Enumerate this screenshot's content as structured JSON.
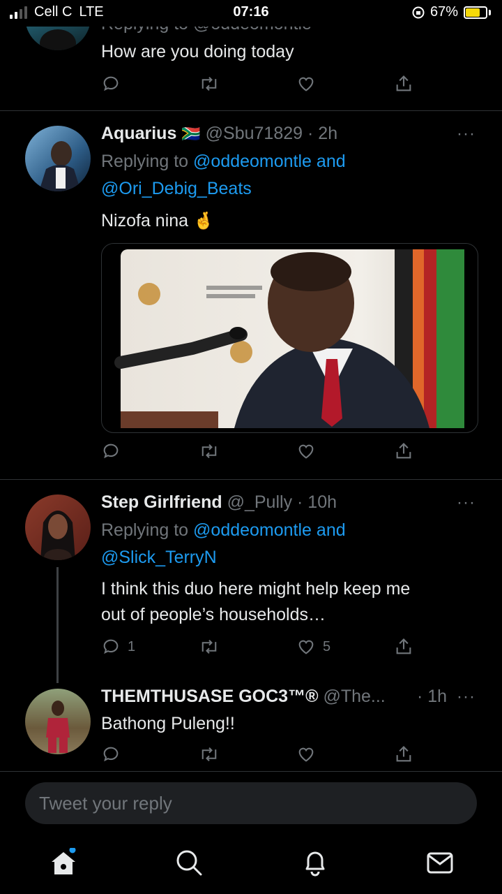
{
  "status_bar": {
    "carrier": "Cell C",
    "network": "LTE",
    "time": "07:16",
    "battery": "67%"
  },
  "tweets": [
    {
      "reply_prefix_partial": "Replying to @oddeomontle",
      "text": "How are you doing today"
    },
    {
      "name": "Aquarius",
      "flag": "🇿🇦",
      "handle": "@Sbu71829",
      "time": "· 2h",
      "reply_prefix": "Replying to",
      "reply_to_1": "@oddeomontle",
      "reply_and": "and",
      "reply_to_2": "@Ori_Debig_Beats",
      "text": "Nizofa nina",
      "emoji": "🤞"
    },
    {
      "name": "Step Girlfriend",
      "handle": "@_Pully",
      "time": "· 10h",
      "reply_prefix": "Replying to",
      "reply_to_1": "@oddeomontle",
      "reply_and": "and",
      "reply_to_2": "@Slick_TerryN",
      "text_line1": "I think this duo here might help keep me",
      "text_line2": "out of people’s households…",
      "reply_count": "1",
      "like_count": "5"
    },
    {
      "name": "THEMTHUSASE GOC3™®",
      "handle": "@The...",
      "time": "· 1h",
      "text": "Bathong Puleng!!"
    }
  ],
  "more_icon": "···",
  "reply_input": {
    "placeholder": "Tweet your reply"
  },
  "tabbar": {
    "items": [
      "home-icon",
      "search-icon",
      "notifications-icon",
      "messages-icon"
    ]
  },
  "colors": {
    "link": "#1d9bf0",
    "muted": "#71767b",
    "text": "#e7e9ea",
    "background": "#000000"
  }
}
